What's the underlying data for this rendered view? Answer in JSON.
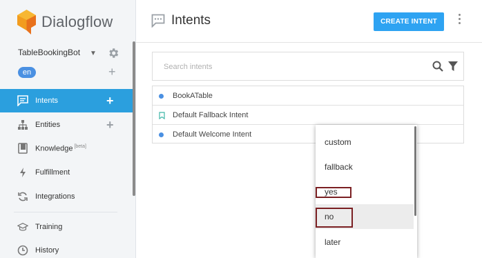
{
  "app": {
    "brand_name": "Dialogflow",
    "brand_colors": [
      "#f29c1f",
      "#e8711c",
      "#f7b733"
    ]
  },
  "sidebar": {
    "agent_name": "TableBookingBot",
    "language": "en",
    "nav": [
      {
        "label": "Intents",
        "icon": "chat-bubble-icon",
        "active": true,
        "has_add": true
      },
      {
        "label": "Entities",
        "icon": "hierarchy-icon",
        "active": false,
        "has_add": true
      },
      {
        "label": "Knowledge",
        "beta": "[beta]",
        "icon": "book-icon",
        "active": false
      },
      {
        "label": "Fulfillment",
        "icon": "lightning-icon",
        "active": false
      },
      {
        "label": "Integrations",
        "icon": "sync-icon",
        "active": false
      },
      {
        "label": "Training",
        "icon": "graduation-cap-icon",
        "active": false
      },
      {
        "label": "History",
        "icon": "clock-icon",
        "active": false
      }
    ]
  },
  "header": {
    "title": "Intents",
    "create_button": "CREATE INTENT"
  },
  "search": {
    "placeholder": "Search intents"
  },
  "intents": [
    {
      "name": "BookATable",
      "marker": "dot"
    },
    {
      "name": "Default Fallback Intent",
      "marker": "bookmark"
    },
    {
      "name": "Default Welcome Intent",
      "marker": "dot"
    }
  ],
  "dropdown": {
    "options": [
      "custom",
      "fallback",
      "yes",
      "no",
      "later"
    ],
    "hovered": "no",
    "highlighted": [
      "yes",
      "no"
    ],
    "highlight_color": "#7a1f22"
  },
  "colors": {
    "accent": "#2b9fde",
    "button": "#2ea3f2",
    "language_badge": "#4a90e2"
  }
}
